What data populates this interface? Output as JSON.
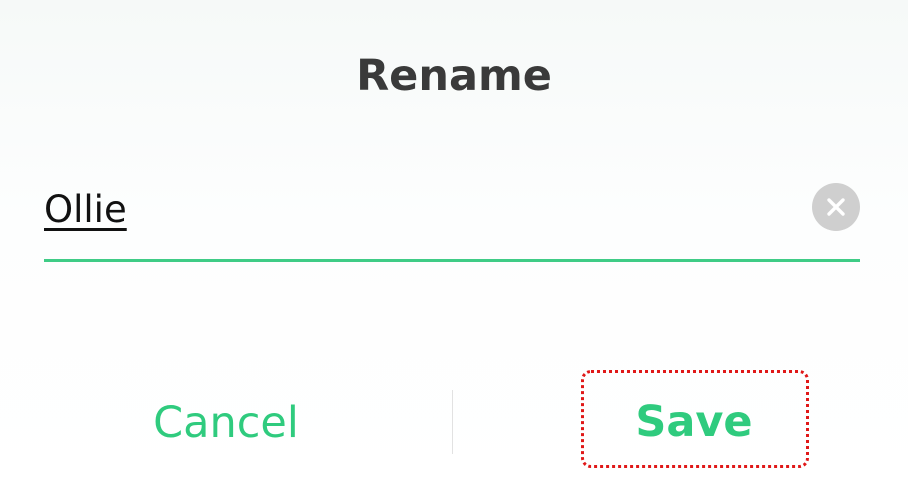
{
  "dialog": {
    "title": "Rename",
    "name_input": {
      "value": "Ollie",
      "placeholder": ""
    },
    "clear_icon": "close-icon",
    "cancel_label": "Cancel",
    "save_label": "Save"
  },
  "colors": {
    "accent": "#2fcb7e",
    "underline": "#3fcc86",
    "title": "#3a3a3a",
    "clear_button_bg": "#cfcfcf",
    "focus_outline": "#e01818"
  }
}
